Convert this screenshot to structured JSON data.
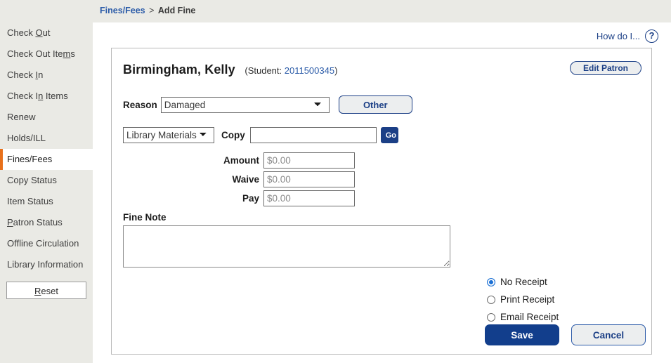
{
  "breadcrumb": {
    "parent": "Fines/Fees",
    "separator": ">",
    "current": "Add Fine"
  },
  "sidebar": {
    "items": [
      {
        "label": "Check Out",
        "pre": "Check ",
        "key": "O",
        "post": "ut",
        "active": false
      },
      {
        "label": "Check Out Items",
        "pre": "Check Out Ite",
        "key": "m",
        "post": "s",
        "active": false
      },
      {
        "label": "Check In",
        "pre": "Check ",
        "key": "I",
        "post": "n",
        "active": false
      },
      {
        "label": "Check In Items",
        "pre": "Check I",
        "key": "n",
        "post": " Items",
        "active": false
      },
      {
        "label": "Renew",
        "pre": "Renew",
        "key": "",
        "post": "",
        "active": false
      },
      {
        "label": "Holds/ILL",
        "pre": "Holds/ILL",
        "key": "",
        "post": "",
        "active": false
      },
      {
        "label": "Fines/Fees",
        "pre": "Fines/Fees",
        "key": "",
        "post": "",
        "active": true
      },
      {
        "label": "Copy Status",
        "pre": "Copy Status",
        "key": "",
        "post": "",
        "active": false
      },
      {
        "label": "Item Status",
        "pre": "Item Status",
        "key": "",
        "post": "",
        "active": false
      },
      {
        "label": "Patron Status",
        "pre": "",
        "key": "P",
        "post": "atron Status",
        "active": false
      },
      {
        "label": "Offline Circulation",
        "pre": "Offline Circulation",
        "key": "",
        "post": "",
        "active": false
      },
      {
        "label": "Library Information",
        "pre": "Library Information",
        "key": "",
        "post": "",
        "active": false
      }
    ],
    "reset_pre": "",
    "reset_key": "R",
    "reset_post": "eset",
    "reset_label": "Reset"
  },
  "help": {
    "label": "How do I...",
    "icon": "question-mark-circle-icon",
    "glyph": "?"
  },
  "patron": {
    "name": "Birmingham, Kelly",
    "meta_prefix": "(Student: ",
    "id": "2011500345",
    "meta_suffix": ")",
    "edit_button": "Edit Patron"
  },
  "form": {
    "reason_label": "Reason",
    "reason_value": "Damaged",
    "reason_options": [
      "Damaged"
    ],
    "other_button": "Other",
    "material_value": "Library Materials",
    "material_options": [
      "Library Materials"
    ],
    "copy_label": "Copy",
    "copy_value": "",
    "copy_placeholder": "",
    "go_button": "Go",
    "amount_label": "Amount",
    "amount_value": "$0.00",
    "waive_label": "Waive",
    "waive_value": "$0.00",
    "pay_label": "Pay",
    "pay_value": "$0.00",
    "fine_note_label": "Fine Note",
    "fine_note_value": ""
  },
  "receipt": {
    "options": [
      {
        "label": "No Receipt",
        "selected": true
      },
      {
        "label": "Print Receipt",
        "selected": false
      },
      {
        "label": "Email Receipt",
        "selected": false
      }
    ]
  },
  "actions": {
    "save_label": "Save",
    "cancel_label": "Cancel"
  },
  "colors": {
    "accent_orange": "#e8701a",
    "brand_navy": "#1b3f86",
    "save_navy": "#123e8c",
    "link_blue": "#2b5ba8",
    "sidebar_bg": "#eaeae5",
    "radio_selected": "#1a6fd4"
  }
}
